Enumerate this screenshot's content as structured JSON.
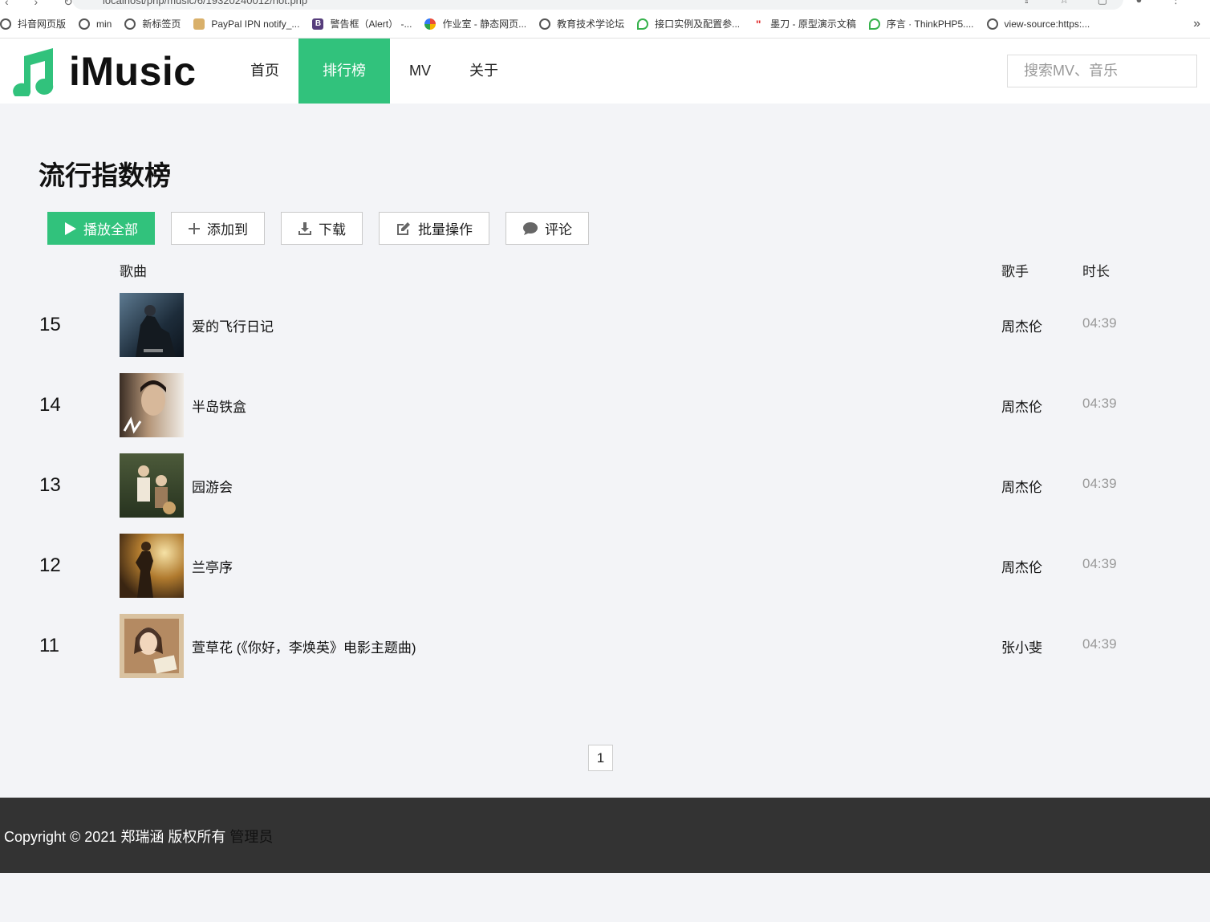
{
  "browser": {
    "url": "localhost/php/music/6/19320240012/hot.php",
    "bookmarks": [
      {
        "label": "抖音网页版",
        "icon": "globe-icon"
      },
      {
        "label": "min",
        "icon": "globe-icon"
      },
      {
        "label": "新标签页",
        "icon": "globe-icon"
      },
      {
        "label": "PayPal IPN notify_...",
        "icon": "avatar-icon"
      },
      {
        "label": "警告框（Alert） -...",
        "icon": "bootstrap-icon"
      },
      {
        "label": "作业室 - 静态网页...",
        "icon": "multicolor-icon"
      },
      {
        "label": "教育技术学论坛",
        "icon": "globe-icon"
      },
      {
        "label": "接口实例及配置参...",
        "icon": "chat-icon"
      },
      {
        "label": "墨刀 - 原型演示文稿",
        "icon": "modao-icon"
      },
      {
        "label": "序言 · ThinkPHP5....",
        "icon": "chat-icon"
      },
      {
        "label": "view-source:https:...",
        "icon": "globe-icon"
      }
    ],
    "more": "»"
  },
  "header": {
    "brand": "iMusic",
    "nav": [
      {
        "label": "首页",
        "active": false
      },
      {
        "label": "排行榜",
        "active": true
      },
      {
        "label": "MV",
        "active": false
      },
      {
        "label": "关于",
        "active": false
      }
    ],
    "search_placeholder": "搜索MV、音乐"
  },
  "main": {
    "title": "流行指数榜",
    "toolbar": {
      "play_all": "播放全部",
      "add_to": "添加到",
      "download": "下载",
      "batch": "批量操作",
      "comment": "评论"
    },
    "columns": {
      "song": "歌曲",
      "singer": "歌手",
      "duration": "时长"
    },
    "songs": [
      {
        "rank": "15",
        "title": "爱的飞行日记",
        "singer": "周杰伦",
        "duration": "04:39"
      },
      {
        "rank": "14",
        "title": "半岛铁盒",
        "singer": "周杰伦",
        "duration": "04:39"
      },
      {
        "rank": "13",
        "title": "园游会",
        "singer": "周杰伦",
        "duration": "04:39"
      },
      {
        "rank": "12",
        "title": "兰亭序",
        "singer": "周杰伦",
        "duration": "04:39"
      },
      {
        "rank": "11",
        "title": "萱草花 (《你好，李焕英》电影主题曲)",
        "singer": "张小斐",
        "duration": "04:39"
      }
    ],
    "pagination": {
      "current": "1"
    }
  },
  "footer": {
    "copyright": "Copyright © 2021 郑瑞涵 版权所有",
    "admin": "管理员"
  },
  "colors": {
    "accent": "#31c27c",
    "footer_bg": "#333333",
    "page_bg": "#f3f4f7"
  }
}
